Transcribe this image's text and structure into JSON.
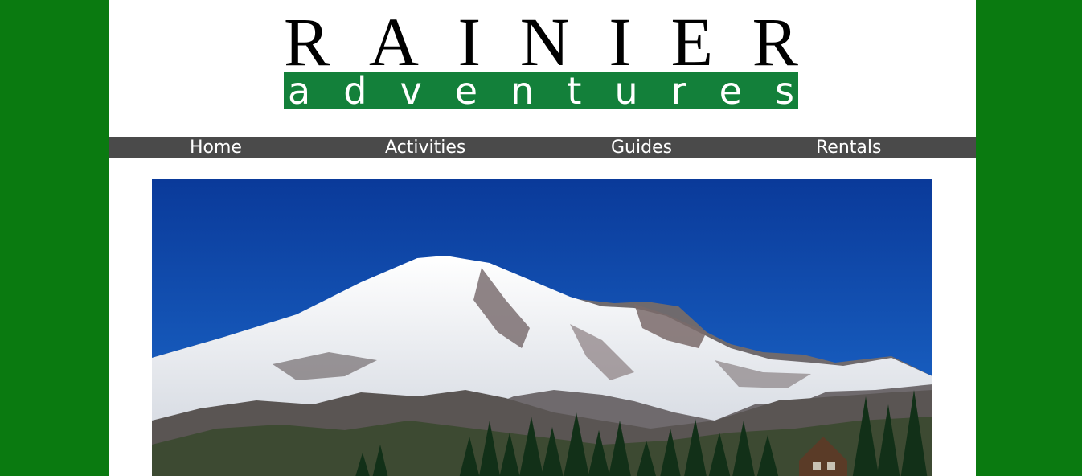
{
  "logo": {
    "top_letters": [
      "R",
      "A",
      "I",
      "N",
      "I",
      "E",
      "R"
    ],
    "bottom_letters": [
      "a",
      "d",
      "v",
      "e",
      "n",
      "t",
      "u",
      "r",
      "e",
      "s"
    ],
    "colors": {
      "top": "#000000",
      "band": "#13803a",
      "band_text": "#ffffff"
    }
  },
  "nav": {
    "items": [
      {
        "label": "Home"
      },
      {
        "label": "Activities"
      },
      {
        "label": "Guides"
      },
      {
        "label": "Rentals"
      }
    ],
    "background": "#4a4a4a"
  },
  "hero": {
    "subject": "mountain-photo"
  },
  "colors": {
    "side_background": "#0a7a10",
    "content_background": "#ffffff"
  }
}
